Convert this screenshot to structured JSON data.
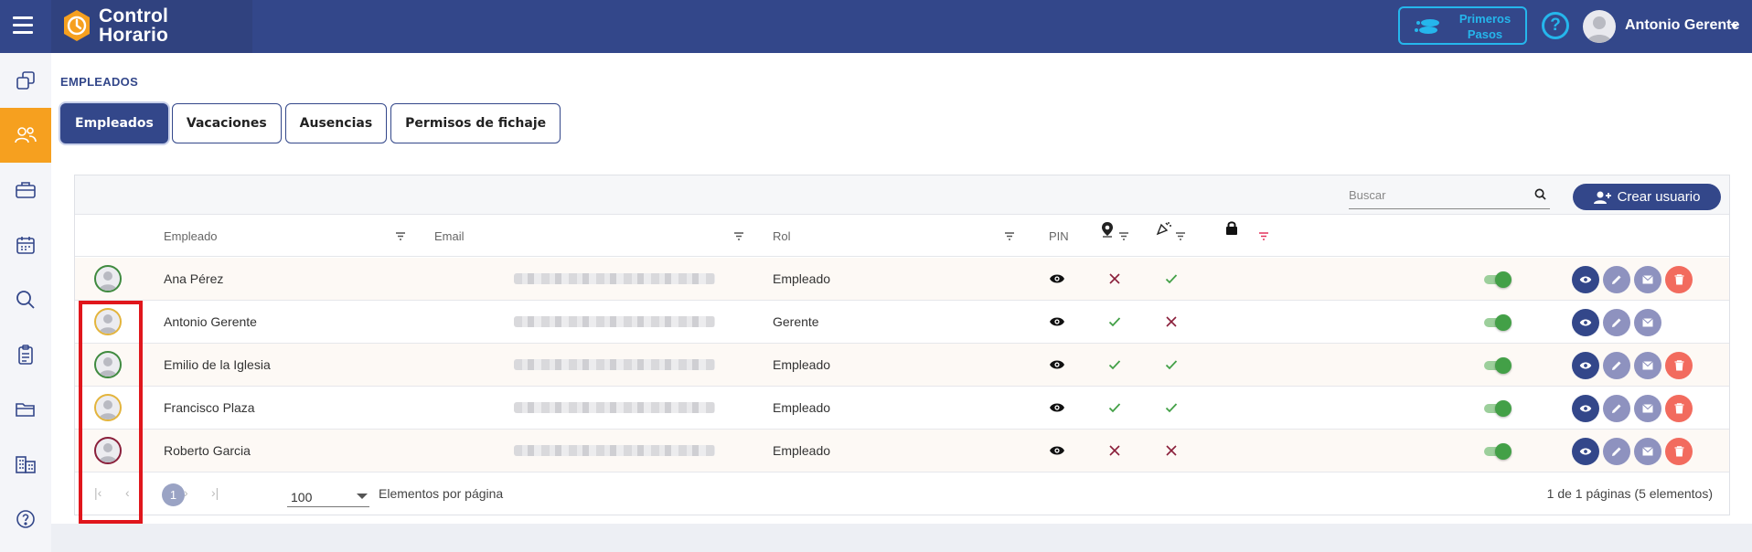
{
  "app": {
    "logo_line1": "Control",
    "logo_line2": "Horario",
    "first_steps_line1": "Primeros",
    "first_steps_line2": "Pasos",
    "help_label": "?",
    "user_name": "Antonio Gerente"
  },
  "sidebar": {
    "items": [
      {
        "icon": "copy-icon"
      },
      {
        "icon": "users-icon",
        "active": true
      },
      {
        "icon": "briefcase-icon"
      },
      {
        "icon": "calendar-icon"
      },
      {
        "icon": "search-icon"
      },
      {
        "icon": "clipboard-icon"
      },
      {
        "icon": "folder-icon"
      },
      {
        "icon": "buildings-icon"
      },
      {
        "icon": "help-icon"
      }
    ]
  },
  "page": {
    "title": "EMPLEADOS",
    "tabs": [
      {
        "label": "Empleados",
        "active": true
      },
      {
        "label": "Vacaciones"
      },
      {
        "label": "Ausencias"
      },
      {
        "label": "Permisos de fichaje"
      }
    ]
  },
  "toolbar": {
    "search_placeholder": "Buscar",
    "create_label": "Crear usuario"
  },
  "table": {
    "headers": {
      "empleado": "Empleado",
      "email": "Email",
      "rol": "Rol",
      "pin": "PIN"
    },
    "rows": [
      {
        "name": "Ana Pérez",
        "role": "Empleado",
        "avatar_color": "#3f8a3f",
        "location": false,
        "remote": true,
        "delete": true
      },
      {
        "name": "Antonio Gerente",
        "role": "Gerente",
        "avatar_color": "#e3b43c",
        "location": true,
        "remote": false,
        "delete": false
      },
      {
        "name": "Emilio de la Iglesia",
        "role": "Empleado",
        "avatar_color": "#3f8a3f",
        "location": true,
        "remote": true,
        "delete": true
      },
      {
        "name": "Francisco Plaza",
        "role": "Empleado",
        "avatar_color": "#e3b43c",
        "location": true,
        "remote": true,
        "delete": true
      },
      {
        "name": "Roberto Garcia",
        "role": "Empleado",
        "avatar_color": "#8a1f3a",
        "location": false,
        "remote": false,
        "delete": true
      }
    ]
  },
  "pagination": {
    "current_page": "1",
    "per_page": "100",
    "per_page_label": "Elementos por página",
    "info": "1 de 1 páginas (5 elementos)"
  },
  "colors": {
    "brand": "#33478a",
    "accent": "#f6a01f",
    "link": "#25b6ec",
    "danger": "#f26b5e",
    "success": "#43a047"
  }
}
